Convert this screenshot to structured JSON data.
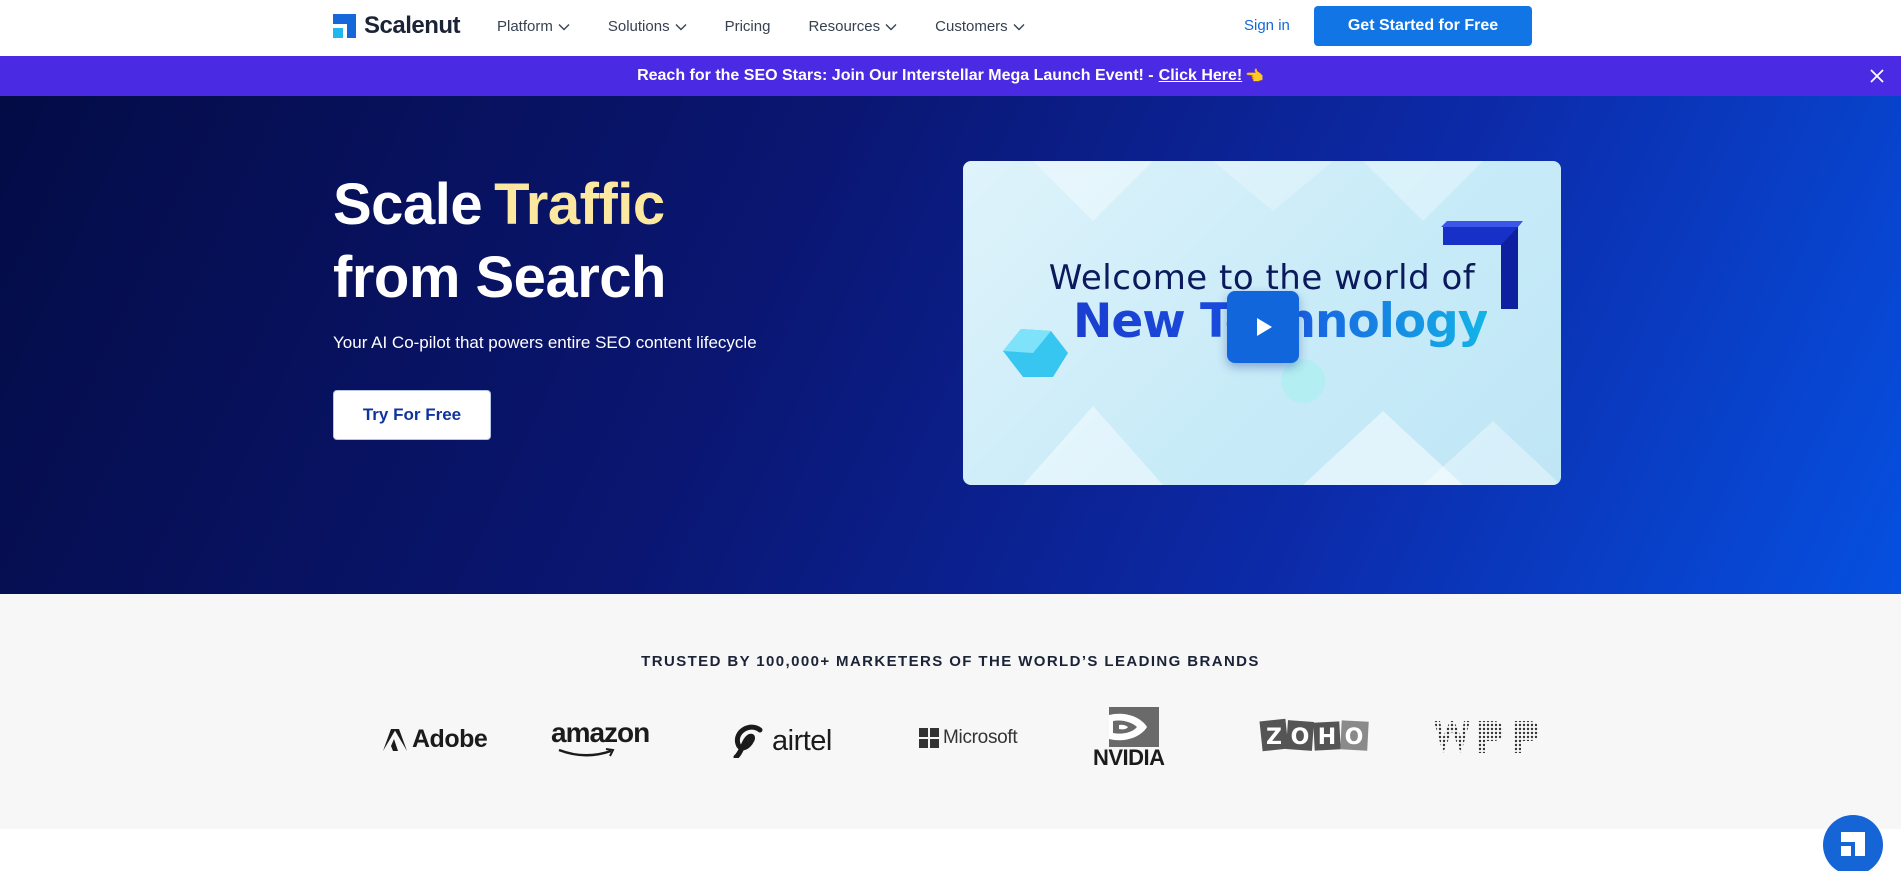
{
  "nav": {
    "logo_text": "Scalenut",
    "menu": [
      {
        "label": "Platform",
        "has_dropdown": true
      },
      {
        "label": "Solutions",
        "has_dropdown": true
      },
      {
        "label": "Pricing",
        "has_dropdown": false
      },
      {
        "label": "Resources",
        "has_dropdown": true
      },
      {
        "label": "Customers",
        "has_dropdown": true
      }
    ],
    "signin_label": "Sign in",
    "cta_label": "Get Started for Free"
  },
  "announcement": {
    "text": "Reach for the SEO Stars: Join Our Interstellar Mega Launch Event! -",
    "link_text": "Click Here!",
    "emoji": "👈"
  },
  "hero": {
    "title_line1_prefix": "Scale",
    "title_highlight": "Traffic",
    "title_line2": "from Search",
    "subtitle": "Your AI Co-pilot that powers entire SEO content lifecycle",
    "button_label": "Try For Free",
    "video": {
      "line1": "Welcome to the world of",
      "line2": "New Technology"
    }
  },
  "trusted": {
    "title": "TRUSTED BY 100,000+ MARKETERS OF THE WORLD’S LEADING BRANDS",
    "brands": [
      "Adobe",
      "amazon",
      "airtel",
      "Microsoft",
      "NVIDIA",
      "ZOHO",
      "WPP"
    ]
  },
  "colors": {
    "primary": "#1275e6",
    "announcement_bg": "#4a2be3",
    "hero_dark": "#040c46",
    "hero_bright": "#0650e0",
    "highlight": "#fde8a0"
  }
}
